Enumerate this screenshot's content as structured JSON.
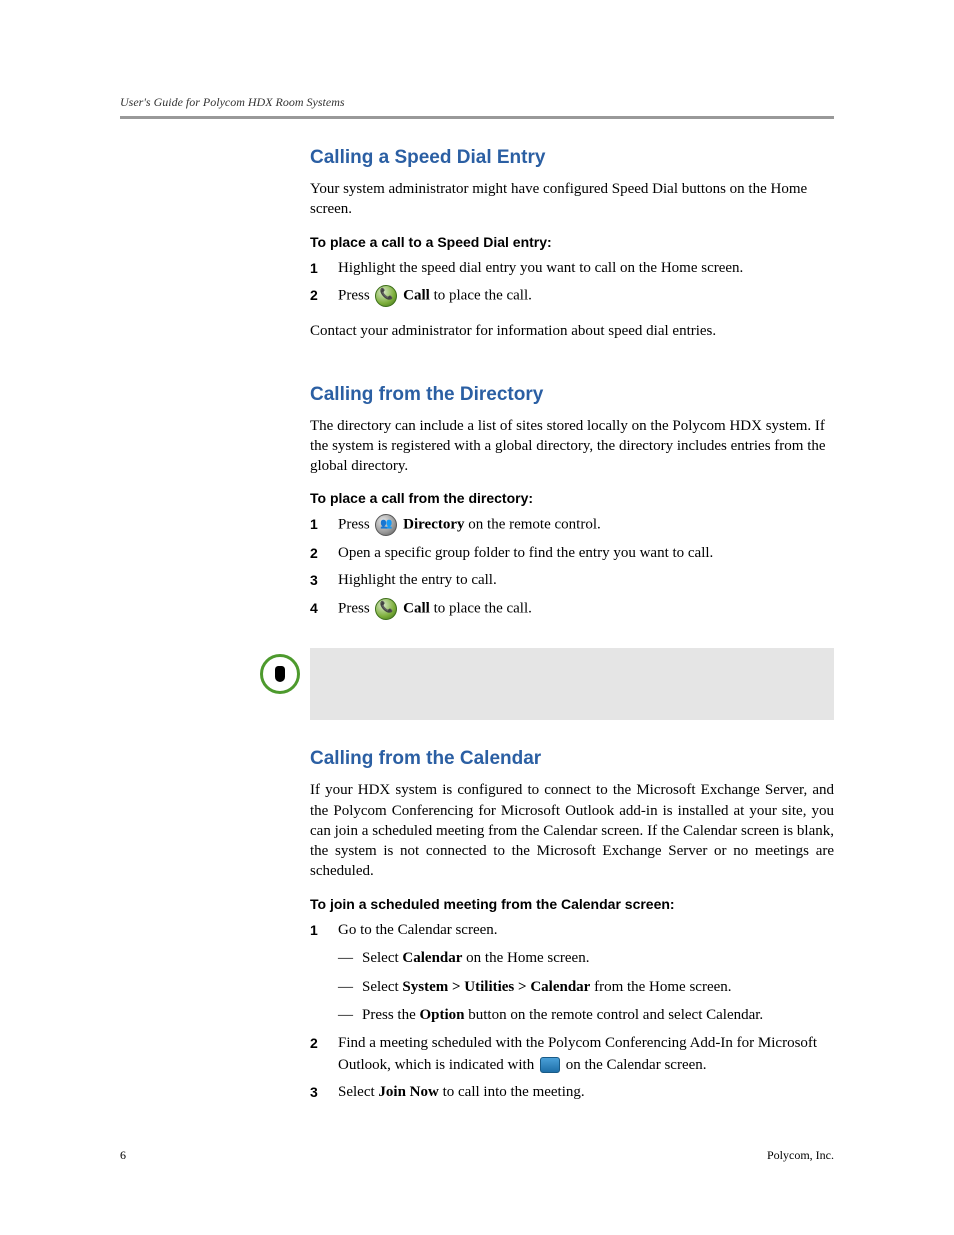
{
  "header": {
    "running_title": "User's Guide for Polycom HDX Room Systems"
  },
  "sections": {
    "speed_dial": {
      "title": "Calling a Speed Dial Entry",
      "intro": "Your system administrator might have configured Speed Dial buttons on the Home screen.",
      "proc_title": "To place a call to a Speed Dial entry:",
      "step1": "Highlight the speed dial entry you want to call on the Home screen.",
      "step2_pre": "Press ",
      "step2_bold": "Call",
      "step2_post": " to place the call.",
      "outro": "Contact your administrator for information about speed dial entries."
    },
    "directory": {
      "title": "Calling from the Directory",
      "intro": "The directory can include a list of sites stored locally on the Polycom HDX system. If the system is registered with a global directory, the directory includes entries from the global directory.",
      "proc_title": "To place a call from the directory:",
      "step1_pre": "Press ",
      "step1_bold": "Directory",
      "step1_post": " on the remote control.",
      "step2": "Open a specific group folder to find the entry you want to call.",
      "step3": "Highlight the entry to call.",
      "step4_pre": "Press ",
      "step4_bold": "Call",
      "step4_post": " to place the call."
    },
    "note": {
      "body": ""
    },
    "calendar": {
      "title": "Calling from the Calendar",
      "intro": "If your HDX system is configured to connect to the Microsoft Exchange Server, and the Polycom Conferencing for Microsoft Outlook add-in is installed at your site, you can join a scheduled meeting from the Calendar screen. If the Calendar screen is blank, the system is not connected to the Microsoft Exchange Server or no meetings are scheduled.",
      "proc_title": "To join a scheduled meeting from the Calendar screen:",
      "step1": "Go to the Calendar screen.",
      "sub_a_pre": "Select ",
      "sub_a_bold": "Calendar",
      "sub_a_post": " on the Home screen.",
      "sub_b_pre": "Select ",
      "sub_b_bold": "System > Utilities > Calendar",
      "sub_b_post": " from the Home screen.",
      "sub_c_pre": "Press the ",
      "sub_c_bold": "Option",
      "sub_c_post": " button on the remote control and select Calendar.",
      "step2_pre": "Find a meeting scheduled with the Polycom Conferencing Add-In for Microsoft Outlook, which is indicated with ",
      "step2_post": " on the Calendar screen.",
      "step3_pre": "Select ",
      "step3_bold": "Join Now",
      "step3_post": " to call into the meeting."
    }
  },
  "footer": {
    "page_number": "6",
    "company": "Polycom, Inc."
  }
}
